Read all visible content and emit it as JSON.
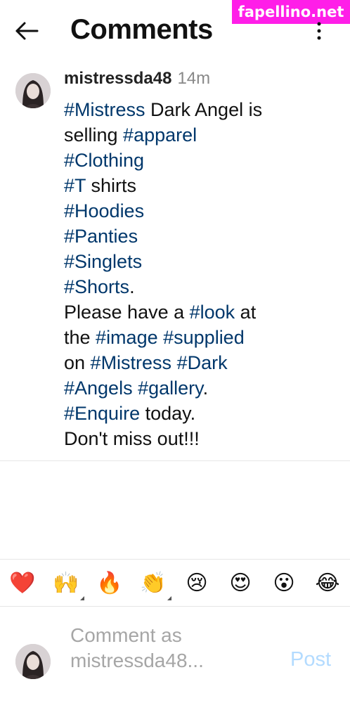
{
  "watermark": "fapellino.net",
  "header": {
    "title": "Comments",
    "back_icon": "arrow-left-icon",
    "more_icon": "more-vertical-icon"
  },
  "comment": {
    "username": "mistressda48",
    "time": "14m",
    "lines": [
      [
        {
          "t": "#Mistress",
          "tag": true
        },
        {
          "t": " Dark Angel is",
          "tag": false
        }
      ],
      [
        {
          "t": "selling ",
          "tag": false
        },
        {
          "t": "#apparel",
          "tag": true
        }
      ],
      [
        {
          "t": "#Clothing",
          "tag": true
        }
      ],
      [
        {
          "t": "#T",
          "tag": true
        },
        {
          "t": " shirts",
          "tag": false
        }
      ],
      [
        {
          "t": "#Hoodies",
          "tag": true
        }
      ],
      [
        {
          "t": "#Panties",
          "tag": true
        }
      ],
      [
        {
          "t": "#Singlets",
          "tag": true
        }
      ],
      [
        {
          "t": "#Shorts",
          "tag": true
        },
        {
          "t": ".",
          "tag": false
        }
      ],
      [
        {
          "t": "Please have a ",
          "tag": false
        },
        {
          "t": "#look",
          "tag": true
        },
        {
          "t": " at",
          "tag": false
        }
      ],
      [
        {
          "t": "the ",
          "tag": false
        },
        {
          "t": "#image",
          "tag": true
        },
        {
          "t": " ",
          "tag": false
        },
        {
          "t": "#supplied",
          "tag": true
        }
      ],
      [
        {
          "t": "on ",
          "tag": false
        },
        {
          "t": "#Mistress",
          "tag": true
        },
        {
          "t": " ",
          "tag": false
        },
        {
          "t": "#Dark",
          "tag": true
        }
      ],
      [
        {
          "t": "#Angels",
          "tag": true
        },
        {
          "t": " ",
          "tag": false
        },
        {
          "t": "#gallery",
          "tag": true
        },
        {
          "t": ".",
          "tag": false
        }
      ],
      [
        {
          "t": "#Enquire",
          "tag": true
        },
        {
          "t": " today.",
          "tag": false
        }
      ],
      [
        {
          "t": "Don't miss out!!!",
          "tag": false
        }
      ]
    ]
  },
  "reactions": [
    {
      "name": "heart-emoji",
      "glyph": "❤️",
      "variant": false
    },
    {
      "name": "raised-hands-emoji",
      "glyph": "🙌",
      "variant": true
    },
    {
      "name": "fire-emoji",
      "glyph": "🔥",
      "variant": false
    },
    {
      "name": "clapping-hands-emoji",
      "glyph": "👏",
      "variant": true
    },
    {
      "name": "crying-face-emoji",
      "glyph": "😢",
      "variant": false
    },
    {
      "name": "heart-eyes-emoji",
      "glyph": "😍",
      "variant": false
    },
    {
      "name": "surprised-face-emoji",
      "glyph": "😮",
      "variant": false
    },
    {
      "name": "tears-of-joy-emoji",
      "glyph": "😂",
      "variant": false
    }
  ],
  "composer": {
    "placeholder_line1": "Comment as",
    "placeholder_line2": "mistressda48...",
    "post_label": "Post"
  },
  "colors": {
    "hashtag": "#00376b",
    "post_disabled": "#b3dbff",
    "watermark_bg": "#ff1ee8",
    "heart": "#e0243b"
  }
}
